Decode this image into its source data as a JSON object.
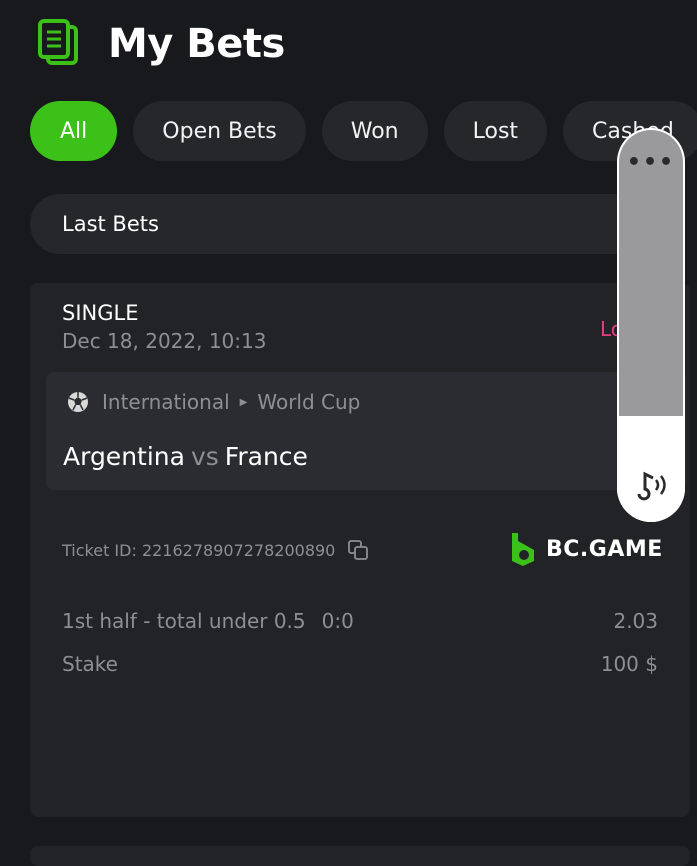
{
  "header": {
    "title": "My Bets",
    "icon": "bets-document-icon"
  },
  "filters": [
    {
      "label": "All",
      "active": true
    },
    {
      "label": "Open Bets",
      "active": false
    },
    {
      "label": "Won",
      "active": false
    },
    {
      "label": "Lost",
      "active": false
    },
    {
      "label": "Cashed",
      "active": false
    }
  ],
  "last_bets": {
    "label": "Last Bets"
  },
  "bet": {
    "type": "SINGLE",
    "date": "Dec 18, 2022, 10:13",
    "status": "Lo",
    "sport_icon": "soccer-ball-icon",
    "category": "International",
    "tournament": "World Cup",
    "team_home": "Argentina",
    "vs": "vs",
    "team_away": "France",
    "ticket_id": "Ticket ID: 2216278907278200890",
    "brand": "BC.GAME",
    "market": "1st half - total under 0.5",
    "score": "0:0",
    "odds": "2.03",
    "stake_label": "Stake",
    "stake_value": "100 $"
  },
  "volume_overlay": {
    "menu": "•••",
    "level": 0.27
  },
  "colors": {
    "accent": "#3bc117",
    "lost": "#e73d85",
    "muted": "#8d8f95"
  }
}
